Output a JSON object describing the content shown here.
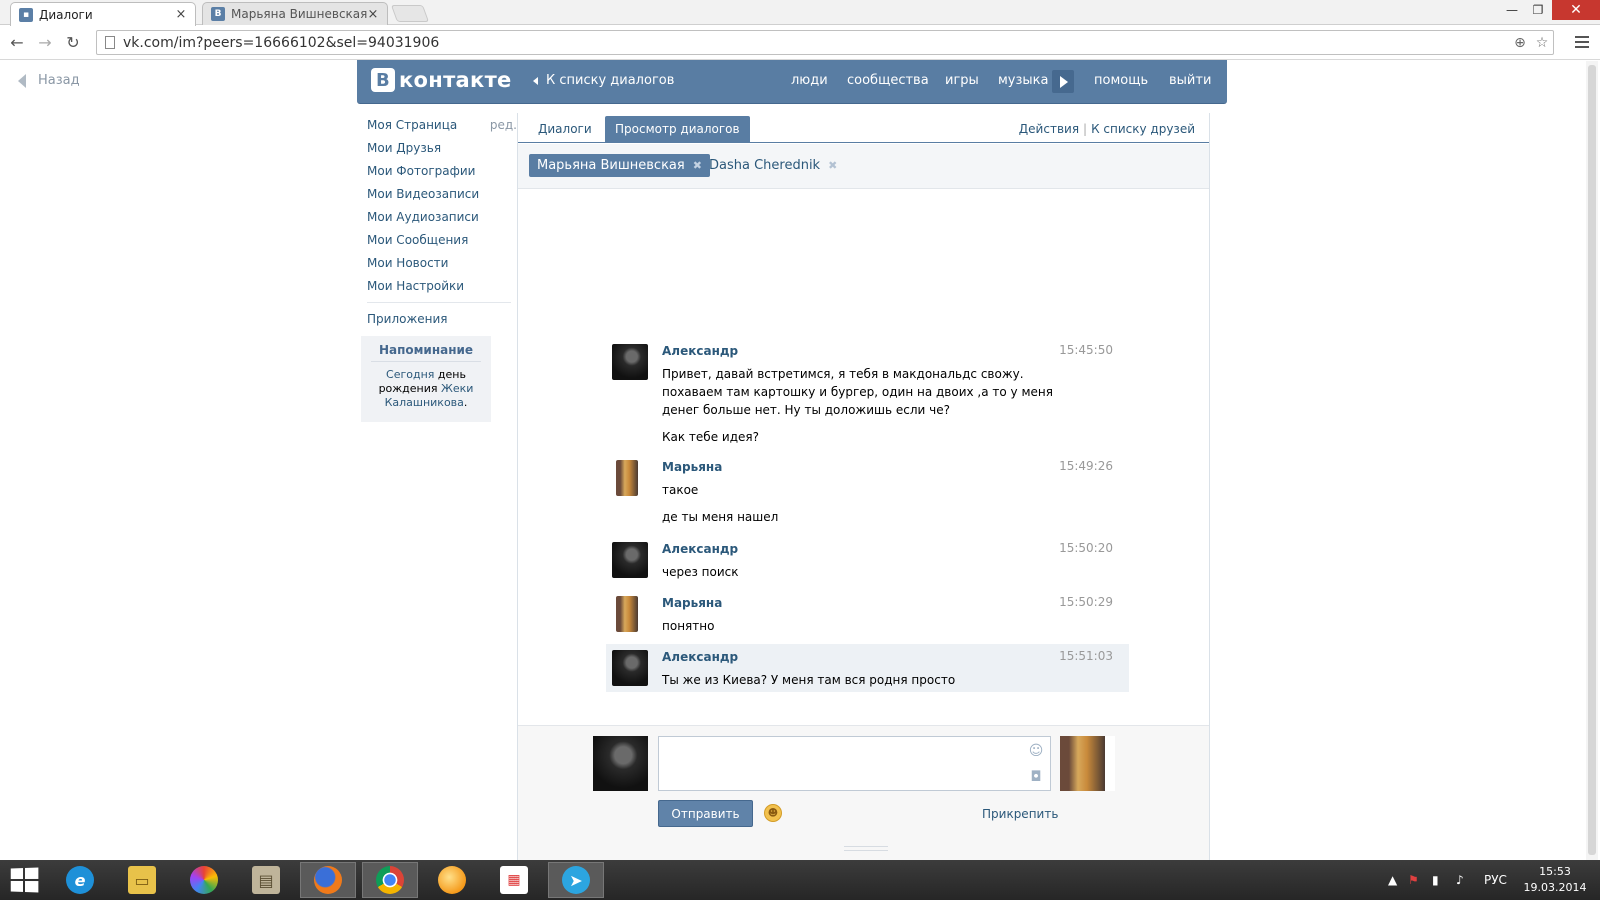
{
  "browser": {
    "tabs": [
      {
        "title": "Диалоги",
        "favicon": "chat-icon",
        "active": true
      },
      {
        "title": "Марьяна Вишневская",
        "favicon": "vk-icon",
        "active": false
      }
    ],
    "url": "vk.com/im?peers=16666102&sel=94031906"
  },
  "page": {
    "back_label": "Назад",
    "header": {
      "logo_text": "контакте",
      "logo_letter": "В",
      "dialog_list_link": "К списку диалогов",
      "nav": [
        "люди",
        "сообщества",
        "игры",
        "музыка",
        "помощь",
        "выйти"
      ]
    },
    "sidebar": {
      "items": [
        "Моя Страница",
        "Мои Друзья",
        "Мои Фотографии",
        "Мои Видеозаписи",
        "Мои Аудиозаписи",
        "Мои Сообщения",
        "Мои Новости",
        "Мои Настройки"
      ],
      "edit_label": "ред.",
      "apps_label": "Приложения"
    },
    "reminder": {
      "title": "Напоминание",
      "today": "Сегодня",
      "birthday_text": "день рождения",
      "name_first": "Жеки",
      "name_last": "Калашникова",
      "period": "."
    },
    "tabs": {
      "dialogs": "Диалоги",
      "view": "Просмотр диалогов",
      "actions": "Действия",
      "separator": "|",
      "friends_link": "К списку друзей"
    },
    "peers": [
      {
        "name": "Марьяна Вишневская",
        "selected": true
      },
      {
        "name": "Dasha Cherednik",
        "selected": false
      }
    ],
    "messages": [
      {
        "author": "Александр",
        "time": "15:45:50",
        "lines": [
          "Привет, давай встретимся, я тебя в макдональдс свожу. похаваем там картошку и бургер, один на двоих ,а то у меня денег больше нет. Ну ты доложишь если че?",
          "Как тебе идея?"
        ]
      },
      {
        "author": "Марьяна",
        "time": "15:49:26",
        "lines": [
          "такое",
          "де ты меня нашел"
        ]
      },
      {
        "author": "Александр",
        "time": "15:50:20",
        "lines": [
          "через поиск"
        ]
      },
      {
        "author": "Марьяна",
        "time": "15:50:29",
        "lines": [
          "понятно"
        ]
      },
      {
        "author": "Александр",
        "time": "15:51:03",
        "lines": [
          "Ты же из Киева? У меня там вся родня просто"
        ]
      }
    ],
    "composer": {
      "send_label": "Отправить",
      "attach_label": "Прикрепить"
    }
  },
  "taskbar": {
    "apps": [
      "internet-explorer",
      "file-explorer",
      "picasa",
      "archive-app",
      "firefox",
      "chrome",
      "messenger-app",
      "app-grid",
      "telegram"
    ],
    "language": "РУС",
    "time": "15:53",
    "date": "19.03.2014"
  },
  "colors": {
    "vk_blue": "#597da3",
    "link": "#2b587a",
    "highlight": "#edf1f5"
  }
}
